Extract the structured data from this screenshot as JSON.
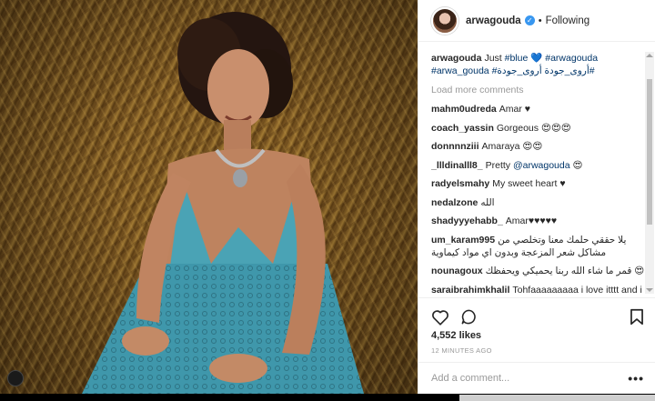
{
  "post": {
    "username": "arwagouda",
    "verified_glyph": "✓",
    "separator": "•",
    "follow_status": "Following",
    "caption": {
      "username": "arwagouda",
      "text_prefix": "Just ",
      "tag1": "#blue",
      "emoji": " 💙 ",
      "tag2": "#arwagouda",
      "line2_tag1": "#arwa_gouda",
      "line2_tag2": "#أروى_جودة",
      "line2_tag3": "أروى_جودة#"
    },
    "load_more": "Load more comments",
    "comments": [
      {
        "user": "mahm0udreda",
        "text": "Amar ♥"
      },
      {
        "user": "coach_yassin",
        "text": "Gorgeous 😍😍😍"
      },
      {
        "user": "donnnnziii",
        "text": "Amaraya 😍😍"
      },
      {
        "user": "_llldinalll8_",
        "text": "Pretty ",
        "mention": "@arwagouda",
        "suffix": " 😍"
      },
      {
        "user": "radyelsmahy",
        "text": "My sweet heart ♥"
      },
      {
        "user": "nedalzone",
        "text": "الله"
      },
      {
        "user": "shadyyyehabb_",
        "text": "Amar♥♥♥♥♥"
      },
      {
        "user": "um_karam995",
        "text": "يلا حققي حلمك معنا وتخلصي من مشاكل شعر المزعجة وبدون اي مواد كيماوية"
      },
      {
        "user": "nounagoux",
        "text": "قمر ما شاء الله ربنا يحميكي ويحفظك 😍"
      },
      {
        "user": "saraibrahimkhalil",
        "text": "Tohfaaaaaaaaa i love itttt and i love uuuu"
      }
    ],
    "likes": "4,552 likes",
    "time": "12 MINUTES AGO",
    "add_comment_placeholder": "Add a comment...",
    "more_glyph": "•••"
  },
  "icons": {
    "heart": "heart-icon",
    "comment": "comment-icon",
    "bookmark": "bookmark-icon"
  },
  "colors": {
    "link": "#003569",
    "verified": "#3897f0",
    "muted": "#999999",
    "dress": "#4aa3b5"
  }
}
